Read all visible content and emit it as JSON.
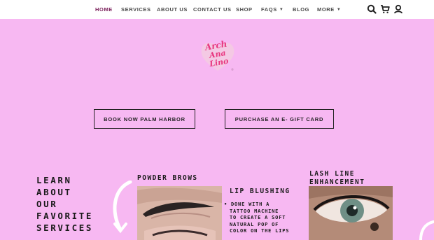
{
  "nav": {
    "items": [
      {
        "label": "HOME"
      },
      {
        "label": "SERVICES"
      },
      {
        "label": "ABOUT US"
      },
      {
        "label": "CONTACT US"
      },
      {
        "label": "SHOP"
      },
      {
        "label": "FAQS"
      },
      {
        "label": "BLOG"
      },
      {
        "label": "MORE"
      }
    ],
    "icons": [
      "search-icon",
      "cart-icon",
      "account-icon"
    ]
  },
  "logo": {
    "text": "Arch Ana Lino"
  },
  "cta": {
    "book": "BOOK NOW PALM HARBOR",
    "gift": "PURCHASE AN E- GIFT CARD"
  },
  "services": {
    "heading_lines": [
      "LEARN",
      "ABOUT",
      "OUR",
      "FAVORITE",
      "SERVICES"
    ],
    "powder_title": "POWDER BROWS",
    "lip_title": "LIP BLUSHING",
    "lip_bullet_lines": [
      "• DONE WITH A",
      "TATTOO MACHINE",
      "TO CREATE A SOFT",
      "NATURAL POP OF",
      "COLOR ON THE LIPS"
    ],
    "lash_title_lines": [
      "LASH LINE",
      "ENHANCEMENT"
    ]
  },
  "colors": {
    "page_bg": "#f7b8f2",
    "nav_bg": "#ffffff",
    "active_nav": "#7a1f5a",
    "logo_pink": "#e8377f"
  }
}
